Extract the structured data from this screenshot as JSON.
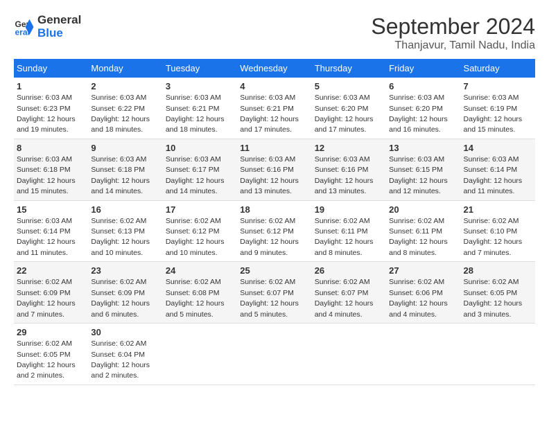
{
  "logo": {
    "line1": "General",
    "line2": "Blue"
  },
  "title": "September 2024",
  "subtitle": "Thanjavur, Tamil Nadu, India",
  "days_header": [
    "Sunday",
    "Monday",
    "Tuesday",
    "Wednesday",
    "Thursday",
    "Friday",
    "Saturday"
  ],
  "weeks": [
    [
      {
        "day": "1",
        "sunrise": "6:03 AM",
        "sunset": "6:23 PM",
        "daylight": "12 hours and 19 minutes."
      },
      {
        "day": "2",
        "sunrise": "6:03 AM",
        "sunset": "6:22 PM",
        "daylight": "12 hours and 18 minutes."
      },
      {
        "day": "3",
        "sunrise": "6:03 AM",
        "sunset": "6:21 PM",
        "daylight": "12 hours and 18 minutes."
      },
      {
        "day": "4",
        "sunrise": "6:03 AM",
        "sunset": "6:21 PM",
        "daylight": "12 hours and 17 minutes."
      },
      {
        "day": "5",
        "sunrise": "6:03 AM",
        "sunset": "6:20 PM",
        "daylight": "12 hours and 17 minutes."
      },
      {
        "day": "6",
        "sunrise": "6:03 AM",
        "sunset": "6:20 PM",
        "daylight": "12 hours and 16 minutes."
      },
      {
        "day": "7",
        "sunrise": "6:03 AM",
        "sunset": "6:19 PM",
        "daylight": "12 hours and 15 minutes."
      }
    ],
    [
      {
        "day": "8",
        "sunrise": "6:03 AM",
        "sunset": "6:18 PM",
        "daylight": "12 hours and 15 minutes."
      },
      {
        "day": "9",
        "sunrise": "6:03 AM",
        "sunset": "6:18 PM",
        "daylight": "12 hours and 14 minutes."
      },
      {
        "day": "10",
        "sunrise": "6:03 AM",
        "sunset": "6:17 PM",
        "daylight": "12 hours and 14 minutes."
      },
      {
        "day": "11",
        "sunrise": "6:03 AM",
        "sunset": "6:16 PM",
        "daylight": "12 hours and 13 minutes."
      },
      {
        "day": "12",
        "sunrise": "6:03 AM",
        "sunset": "6:16 PM",
        "daylight": "12 hours and 13 minutes."
      },
      {
        "day": "13",
        "sunrise": "6:03 AM",
        "sunset": "6:15 PM",
        "daylight": "12 hours and 12 minutes."
      },
      {
        "day": "14",
        "sunrise": "6:03 AM",
        "sunset": "6:14 PM",
        "daylight": "12 hours and 11 minutes."
      }
    ],
    [
      {
        "day": "15",
        "sunrise": "6:03 AM",
        "sunset": "6:14 PM",
        "daylight": "12 hours and 11 minutes."
      },
      {
        "day": "16",
        "sunrise": "6:02 AM",
        "sunset": "6:13 PM",
        "daylight": "12 hours and 10 minutes."
      },
      {
        "day": "17",
        "sunrise": "6:02 AM",
        "sunset": "6:12 PM",
        "daylight": "12 hours and 10 minutes."
      },
      {
        "day": "18",
        "sunrise": "6:02 AM",
        "sunset": "6:12 PM",
        "daylight": "12 hours and 9 minutes."
      },
      {
        "day": "19",
        "sunrise": "6:02 AM",
        "sunset": "6:11 PM",
        "daylight": "12 hours and 8 minutes."
      },
      {
        "day": "20",
        "sunrise": "6:02 AM",
        "sunset": "6:11 PM",
        "daylight": "12 hours and 8 minutes."
      },
      {
        "day": "21",
        "sunrise": "6:02 AM",
        "sunset": "6:10 PM",
        "daylight": "12 hours and 7 minutes."
      }
    ],
    [
      {
        "day": "22",
        "sunrise": "6:02 AM",
        "sunset": "6:09 PM",
        "daylight": "12 hours and 7 minutes."
      },
      {
        "day": "23",
        "sunrise": "6:02 AM",
        "sunset": "6:09 PM",
        "daylight": "12 hours and 6 minutes."
      },
      {
        "day": "24",
        "sunrise": "6:02 AM",
        "sunset": "6:08 PM",
        "daylight": "12 hours and 5 minutes."
      },
      {
        "day": "25",
        "sunrise": "6:02 AM",
        "sunset": "6:07 PM",
        "daylight": "12 hours and 5 minutes."
      },
      {
        "day": "26",
        "sunrise": "6:02 AM",
        "sunset": "6:07 PM",
        "daylight": "12 hours and 4 minutes."
      },
      {
        "day": "27",
        "sunrise": "6:02 AM",
        "sunset": "6:06 PM",
        "daylight": "12 hours and 4 minutes."
      },
      {
        "day": "28",
        "sunrise": "6:02 AM",
        "sunset": "6:05 PM",
        "daylight": "12 hours and 3 minutes."
      }
    ],
    [
      {
        "day": "29",
        "sunrise": "6:02 AM",
        "sunset": "6:05 PM",
        "daylight": "12 hours and 2 minutes."
      },
      {
        "day": "30",
        "sunrise": "6:02 AM",
        "sunset": "6:04 PM",
        "daylight": "12 hours and 2 minutes."
      },
      null,
      null,
      null,
      null,
      null
    ]
  ]
}
